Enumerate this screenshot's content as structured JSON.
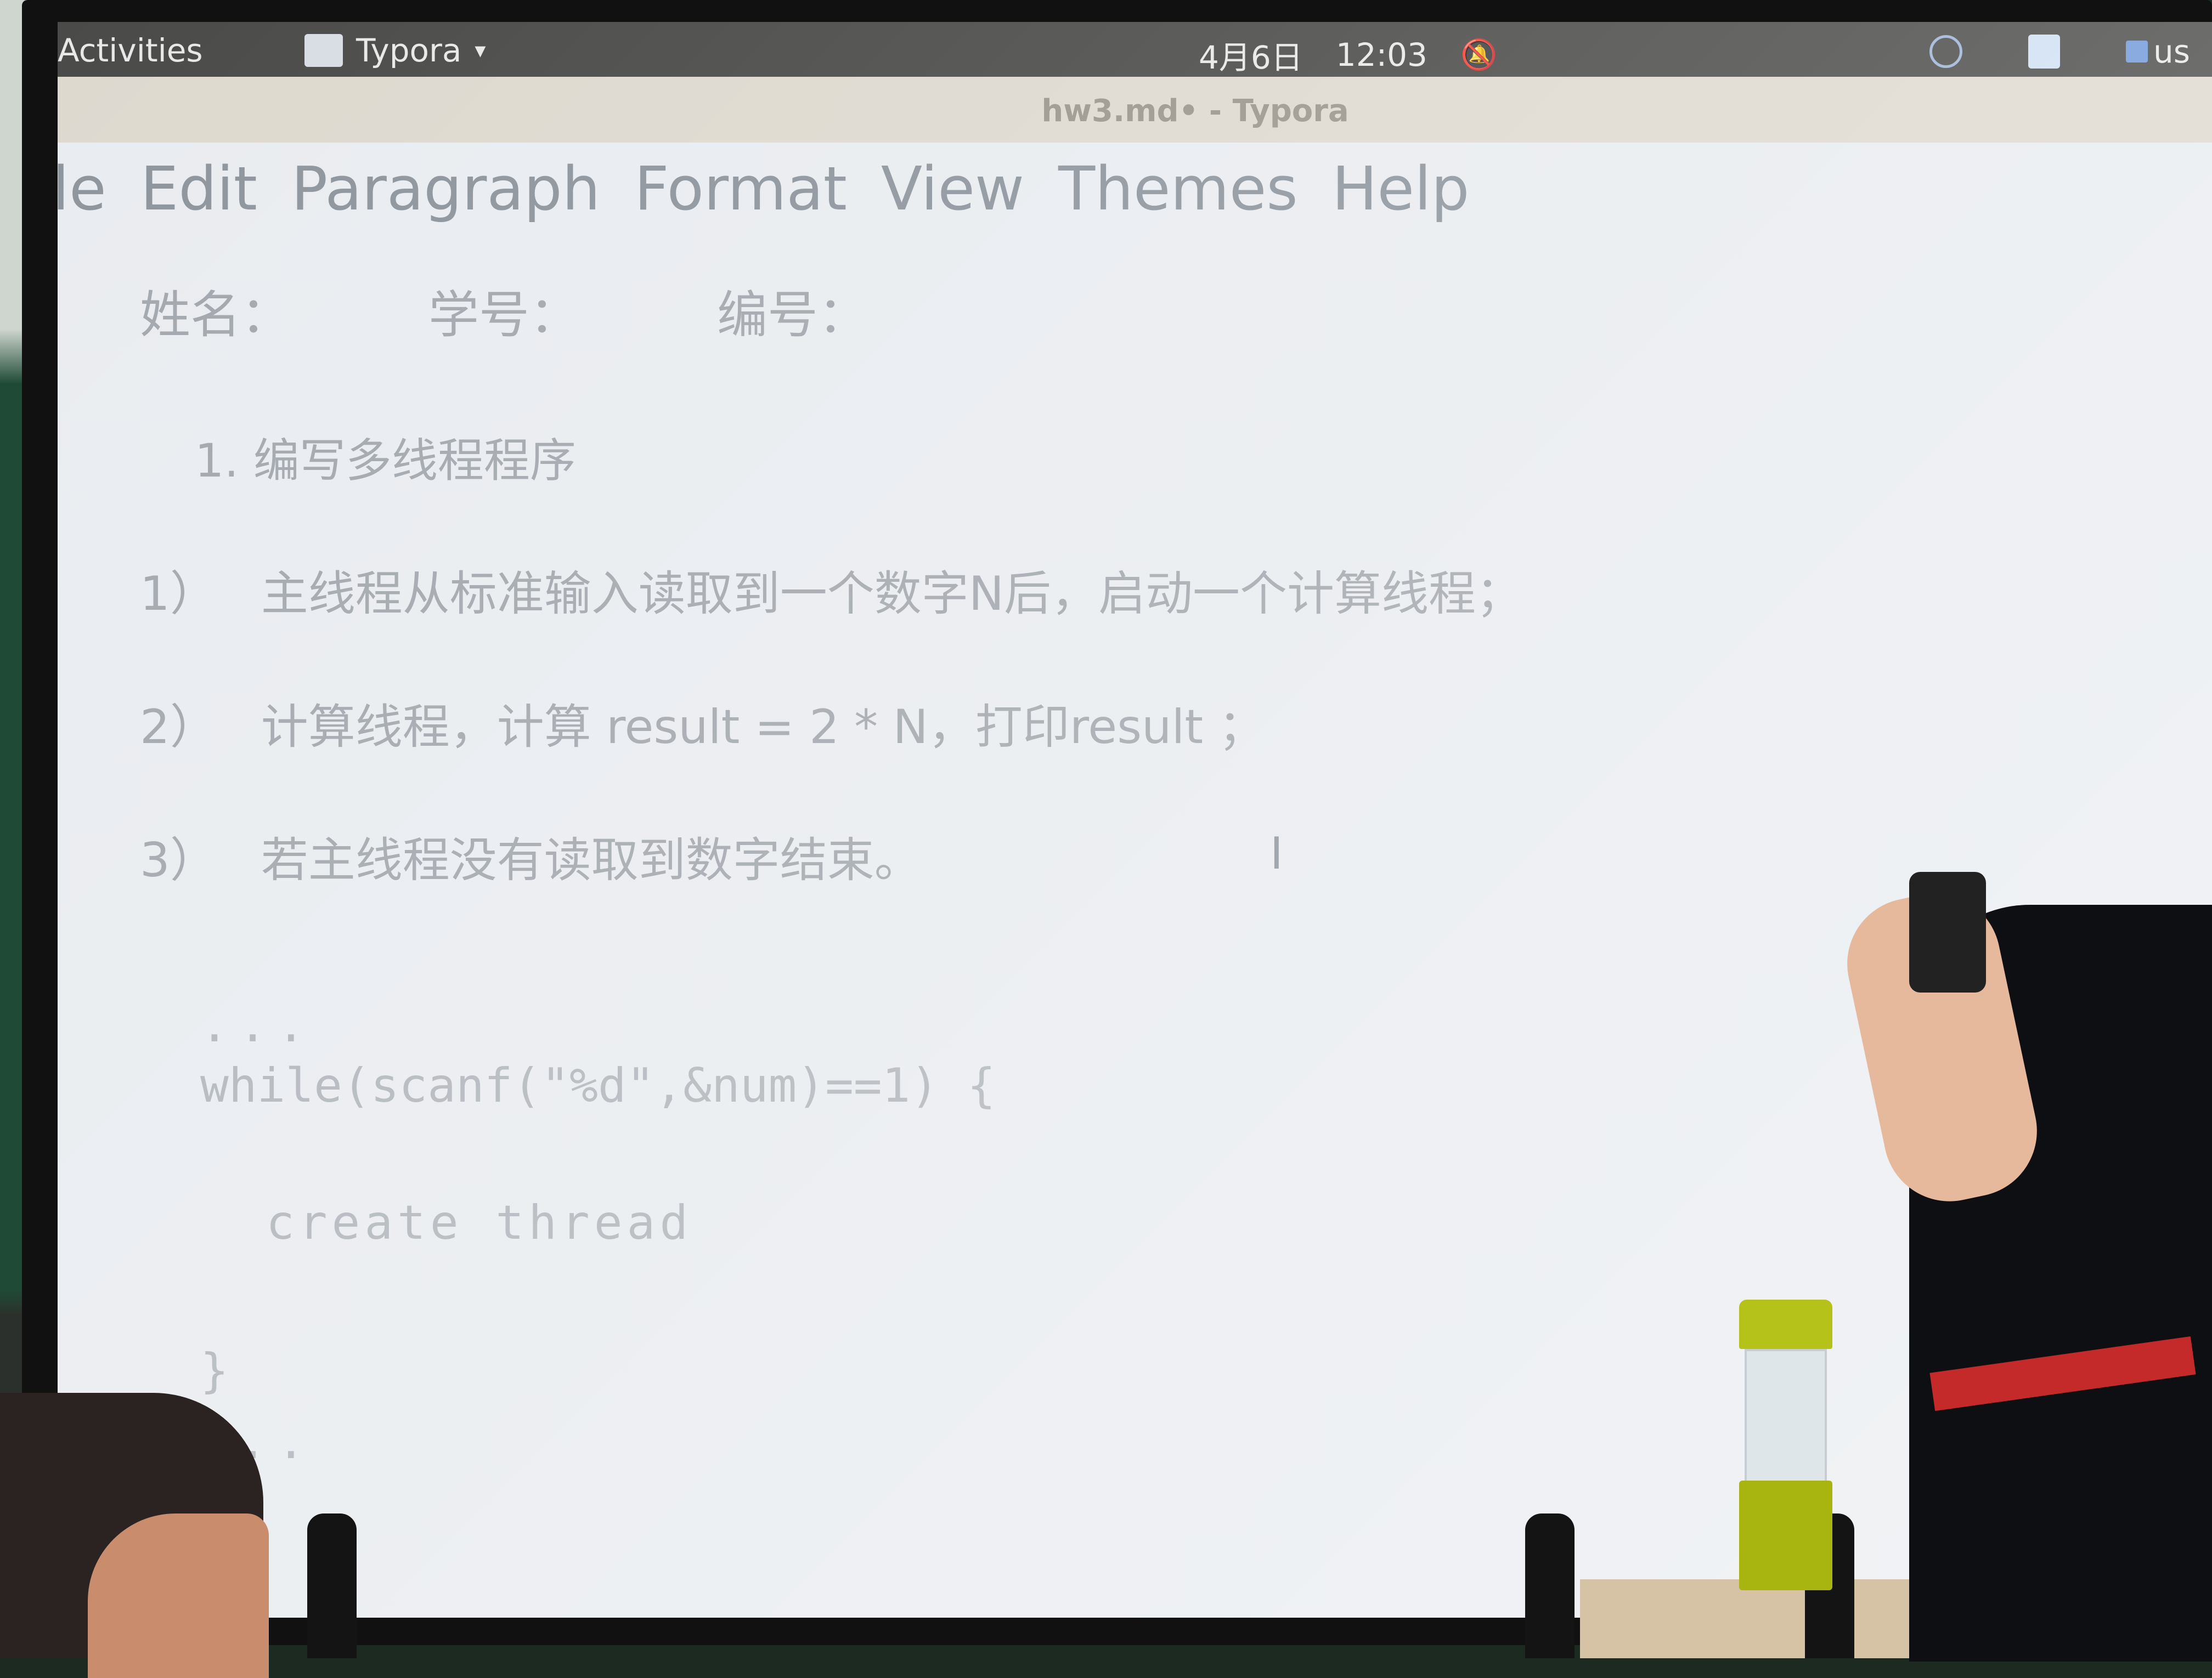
{
  "system_bar": {
    "activities": "Activities",
    "app_name": "Typora",
    "app_caret": "▾",
    "date": "4月6日",
    "time": "12:03",
    "keyboard_layout": "us",
    "icons": [
      "app-icon",
      "notifications-off-icon",
      "sync-icon",
      "document-icon",
      "keyboard-icon"
    ]
  },
  "window": {
    "title": "hw3.md• - Typora"
  },
  "menu": {
    "items": [
      "File",
      "Edit",
      "Paragraph",
      "Format",
      "View",
      "Themes",
      "Help"
    ],
    "first_visible": "ile"
  },
  "document": {
    "fields": [
      "姓名：",
      "学号：",
      "编号："
    ],
    "heading": "1. 编写多线程程序",
    "items": [
      {
        "num": "1）",
        "text": "主线程从标准输入读取到一个数字N后，启动一个计算线程；"
      },
      {
        "num": "2）",
        "text": "计算线程，计算 result = 2 * N，打印result ；"
      },
      {
        "num": "3）",
        "text": "若主线程没有读取到数字结束。"
      }
    ],
    "cursor": "I",
    "code": {
      "fence_open": "...",
      "line1": "while(scanf(\"%d\",&num)==1) {",
      "line2": "create thread",
      "line3": "}",
      "fence_close": "..."
    }
  },
  "colors": {
    "top_bar": "#4a4a48",
    "title_bar": "#ded9cf",
    "editor_bg": "#e9ecf0",
    "text": "#a2a7ad"
  }
}
